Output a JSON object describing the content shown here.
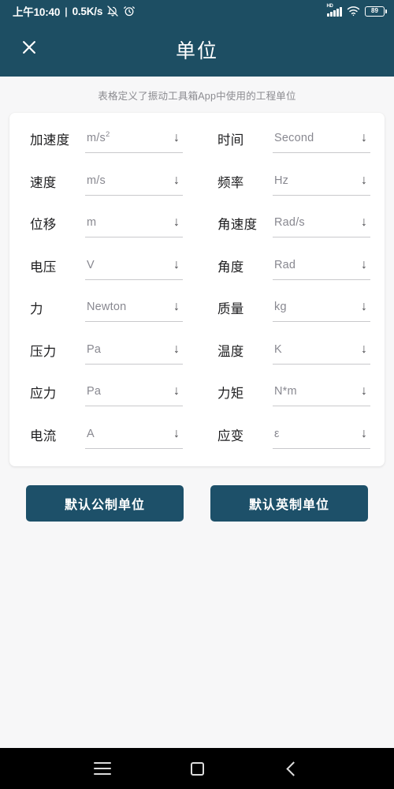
{
  "status_bar": {
    "time": "上午10:40",
    "separator": "|",
    "network_speed": "0.5K/s",
    "mute_icon": "mute-bell-icon",
    "alarm_icon": "alarm-clock-icon",
    "hd_label": "HD",
    "signal_icon": "signal-bars-icon",
    "wifi_icon": "wifi-icon",
    "battery_level": "89"
  },
  "app_bar": {
    "close_icon": "close-icon",
    "title": "单位"
  },
  "subtitle": "表格定义了振动工具箱App中使用的工程单位",
  "table": {
    "rows": [
      {
        "left": {
          "label": "加速度",
          "value": "m/s",
          "sup": "2",
          "arrow": "↓"
        },
        "right": {
          "label": "时间",
          "value": "Second",
          "sup": "",
          "arrow": "↓"
        }
      },
      {
        "left": {
          "label": "速度",
          "value": "m/s",
          "sup": "",
          "arrow": "↓"
        },
        "right": {
          "label": "频率",
          "value": "Hz",
          "sup": "",
          "arrow": "↓"
        }
      },
      {
        "left": {
          "label": "位移",
          "value": "m",
          "sup": "",
          "arrow": "↓"
        },
        "right": {
          "label": "角速度",
          "value": "Rad/s",
          "sup": "",
          "arrow": "↓"
        }
      },
      {
        "left": {
          "label": "电压",
          "value": "V",
          "sup": "",
          "arrow": "↓"
        },
        "right": {
          "label": "角度",
          "value": "Rad",
          "sup": "",
          "arrow": "↓"
        }
      },
      {
        "left": {
          "label": "力",
          "value": "Newton",
          "sup": "",
          "arrow": "↓"
        },
        "right": {
          "label": "质量",
          "value": "kg",
          "sup": "",
          "arrow": "↓"
        }
      },
      {
        "left": {
          "label": "压力",
          "value": "Pa",
          "sup": "",
          "arrow": "↓"
        },
        "right": {
          "label": "温度",
          "value": "K",
          "sup": "",
          "arrow": "↓"
        }
      },
      {
        "left": {
          "label": "应力",
          "value": "Pa",
          "sup": "",
          "arrow": "↓"
        },
        "right": {
          "label": "力矩",
          "value": "N*m",
          "sup": "",
          "arrow": "↓"
        }
      },
      {
        "left": {
          "label": "电流",
          "value": "A",
          "sup": "",
          "arrow": "↓"
        },
        "right": {
          "label": "应变",
          "value": "ε",
          "sup": "",
          "arrow": "↓"
        }
      }
    ]
  },
  "buttons": {
    "metric": "默认公制单位",
    "imperial": "默认英制单位"
  },
  "nav_bar": {
    "menu_icon": "menu-icon",
    "home_icon": "home-square-icon",
    "back_icon": "back-chevron-icon"
  },
  "colors": {
    "brand_teal": "#1d4e63",
    "button_teal": "#1d5069",
    "page_background": "#f7f7f8",
    "card_background": "#ffffff",
    "label_text": "#1d1d1f",
    "value_text": "#888890",
    "subtitle_text": "#8b8b90",
    "nav_background": "#000000"
  }
}
